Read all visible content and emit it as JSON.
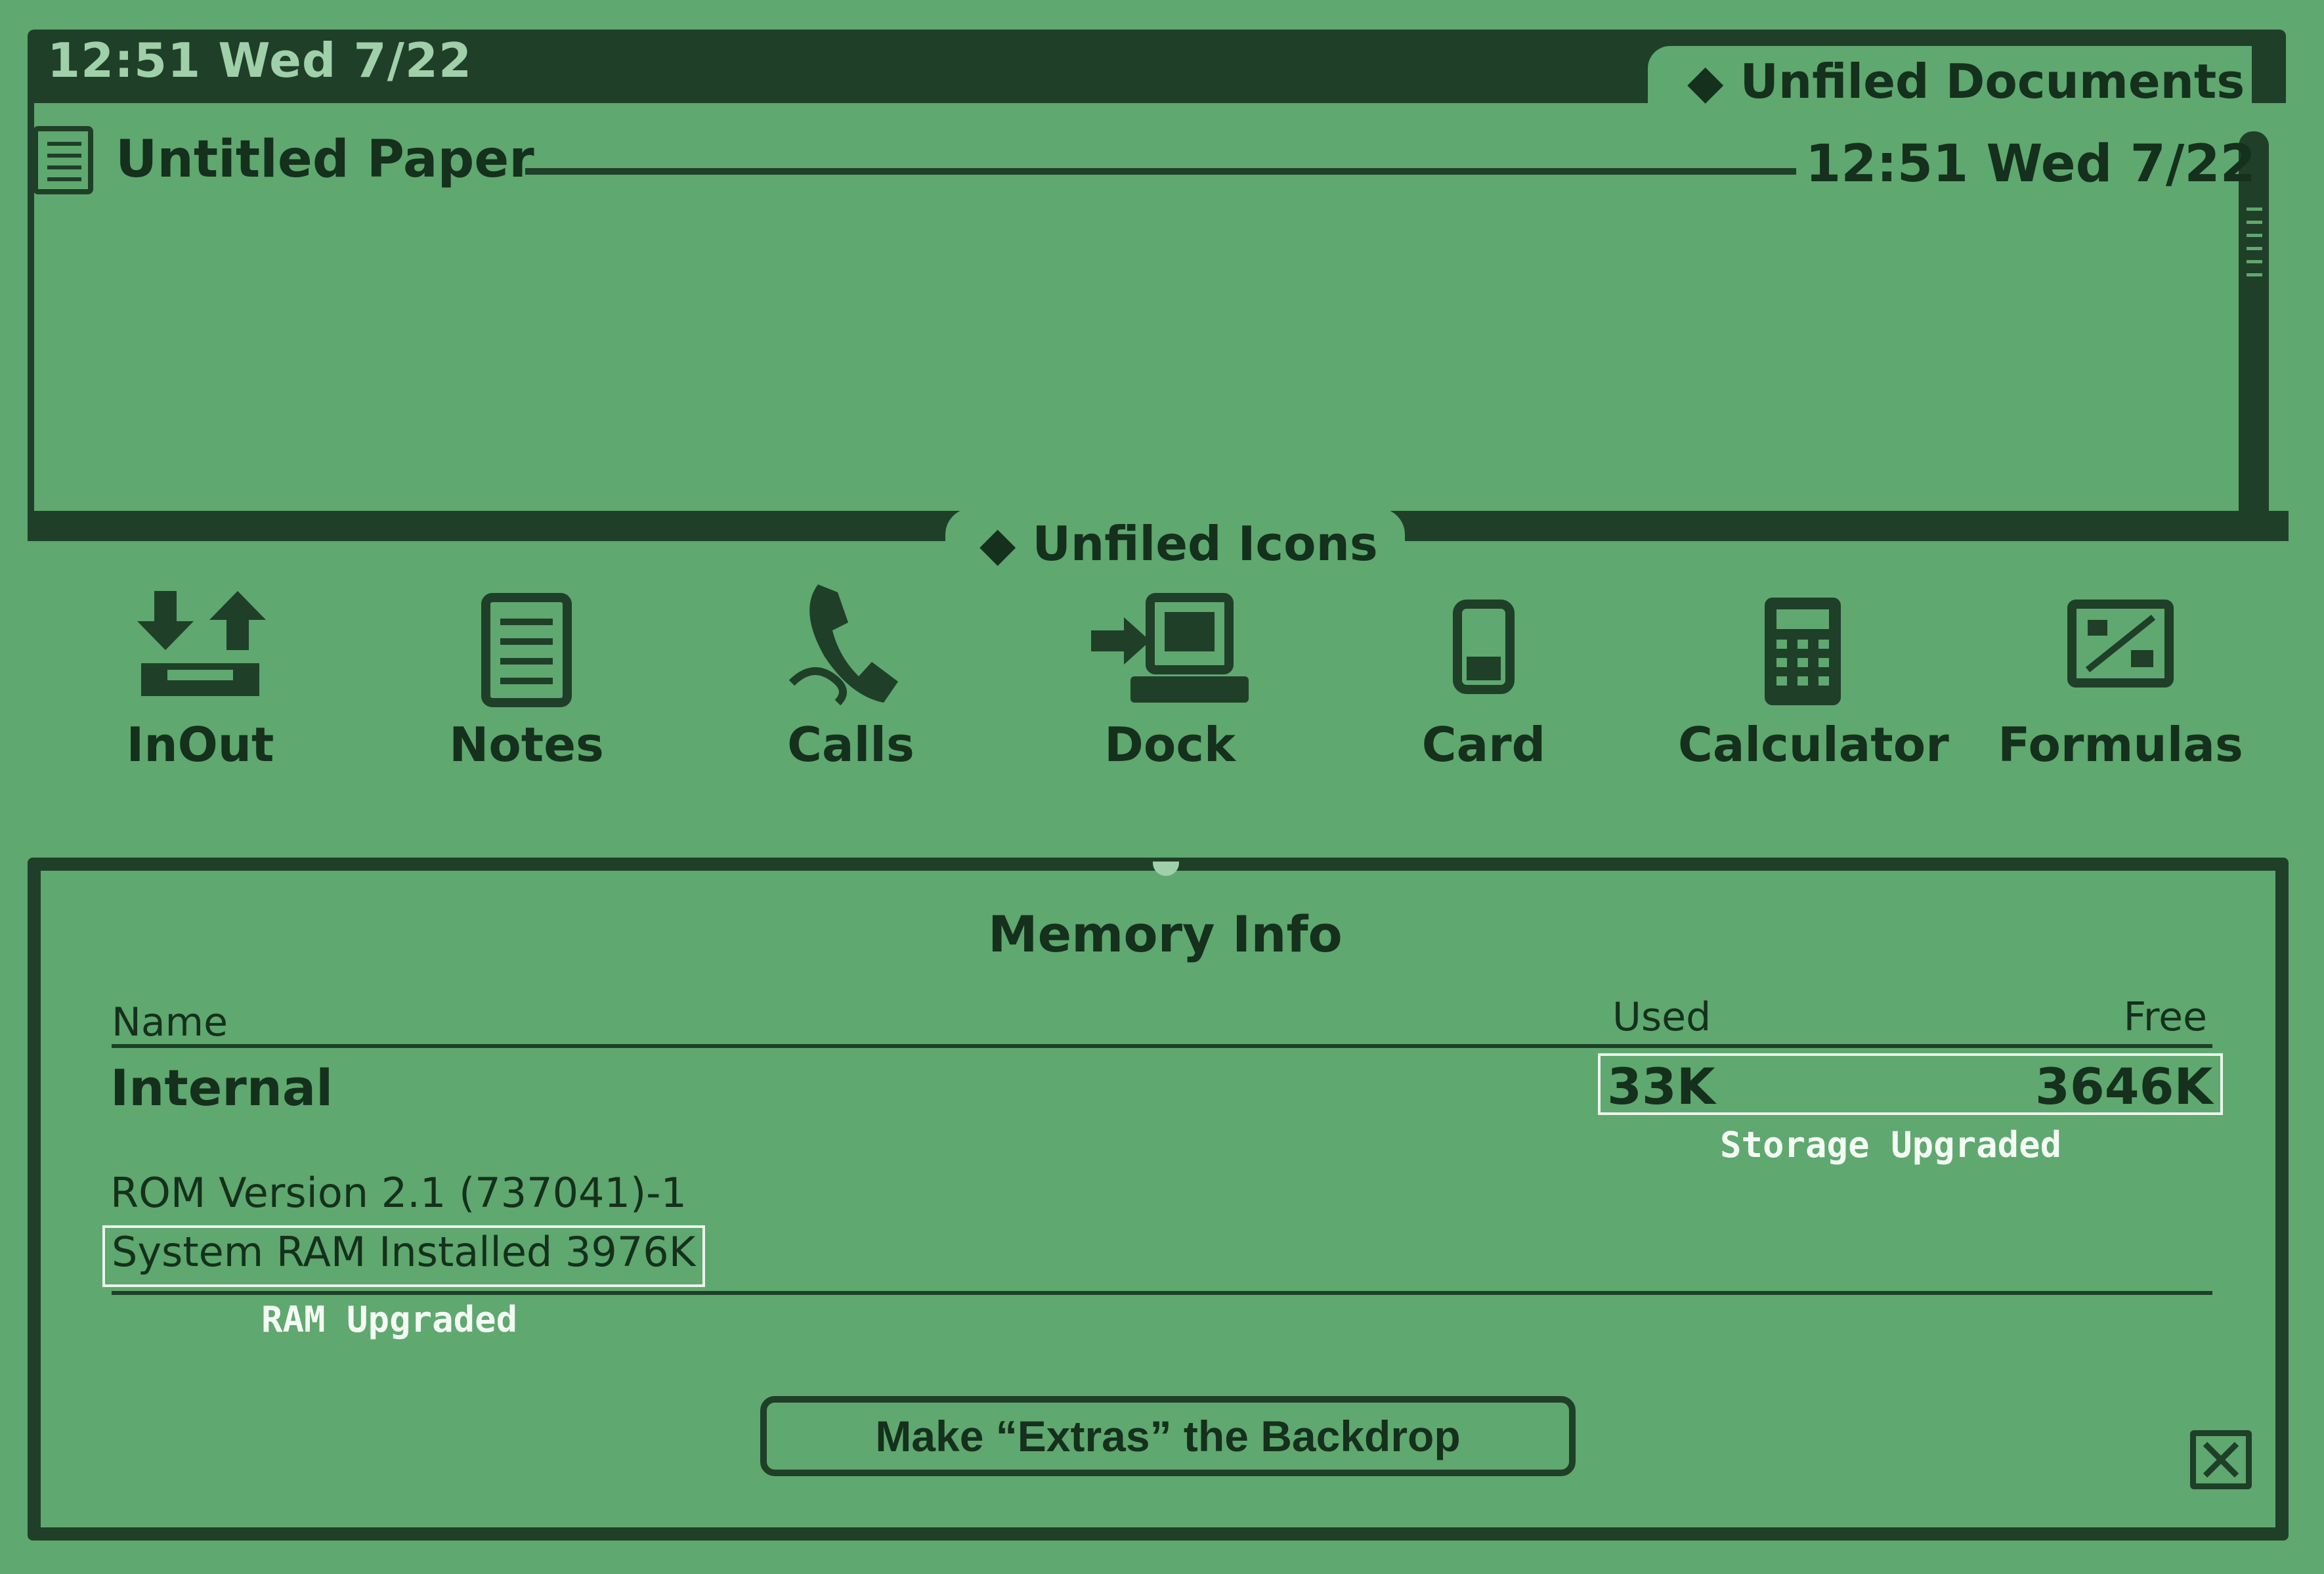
{
  "status_bar": {
    "clock": "12:51 Wed 7/22"
  },
  "notepad": {
    "folder_tab": "◆ Unfiled Documents",
    "note_title": "Untitled Paper",
    "note_timestamp": "12:51 Wed 7/22"
  },
  "extras": {
    "folder_tab": "◆ Unfiled Icons",
    "apps": [
      {
        "label": "InOut",
        "icon": "inout-icon"
      },
      {
        "label": "Notes",
        "icon": "notes-icon"
      },
      {
        "label": "Calls",
        "icon": "phone-icon"
      },
      {
        "label": "Dock",
        "icon": "dock-icon"
      },
      {
        "label": "Card",
        "icon": "card-icon"
      },
      {
        "label": "Calculator",
        "icon": "calculator-icon"
      },
      {
        "label": "Formulas",
        "icon": "formulas-icon"
      }
    ]
  },
  "memory_info": {
    "title": "Memory Info",
    "columns": {
      "name": "Name",
      "used": "Used",
      "free": "Free"
    },
    "rows": [
      {
        "name": "Internal",
        "used": "33K",
        "free": "3646K"
      }
    ],
    "rom_version": "ROM Version 2.1 (737041)-1",
    "system_ram": "System RAM Installed 3976K",
    "backdrop_button": "Make “Extras” the Backdrop"
  },
  "annotations": {
    "storage": "Storage Upgraded",
    "ram": "RAM Upgraded"
  },
  "colors": {
    "screen": "#5fa86f",
    "ink": "#1f3f28",
    "annotation": "#f4faf4"
  }
}
